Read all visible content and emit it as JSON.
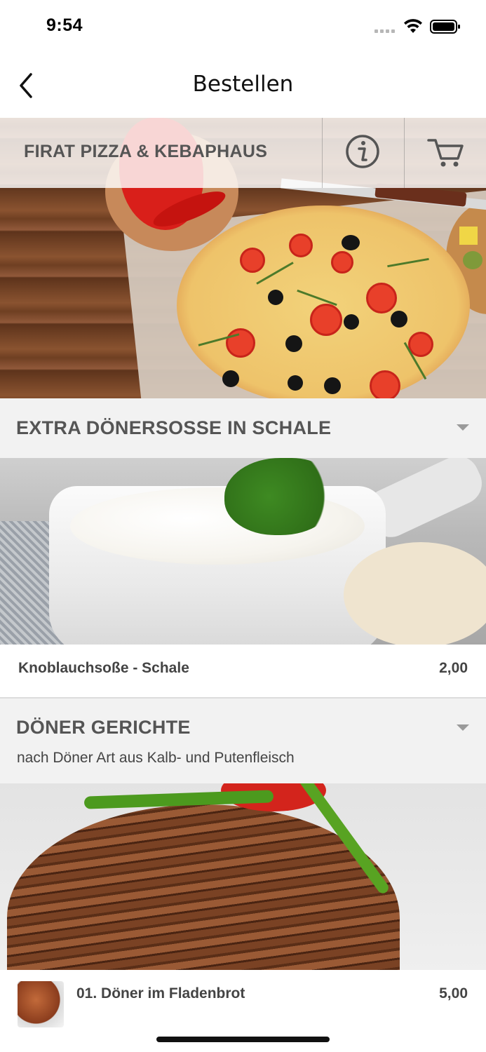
{
  "status_bar": {
    "time": "9:54"
  },
  "nav": {
    "title": "Bestellen",
    "back_icon": "chevron-left-icon"
  },
  "restaurant": {
    "name": "FIRAT PIZZA & KEBAPHAUS",
    "info_icon": "info-icon",
    "cart_icon": "cart-icon"
  },
  "categories": [
    {
      "title": "EXTRA DÖNERSOSSE IN SCHALE",
      "items": [
        {
          "name": "Knoblauchsoße - Schale",
          "price": "2,00"
        }
      ]
    },
    {
      "title": "DÖNER GERICHTE",
      "subtitle": "nach Döner Art aus Kalb- und Putenfleisch",
      "items": [
        {
          "name": "01. Döner im Fladenbrot",
          "price": "5,00"
        }
      ]
    }
  ]
}
